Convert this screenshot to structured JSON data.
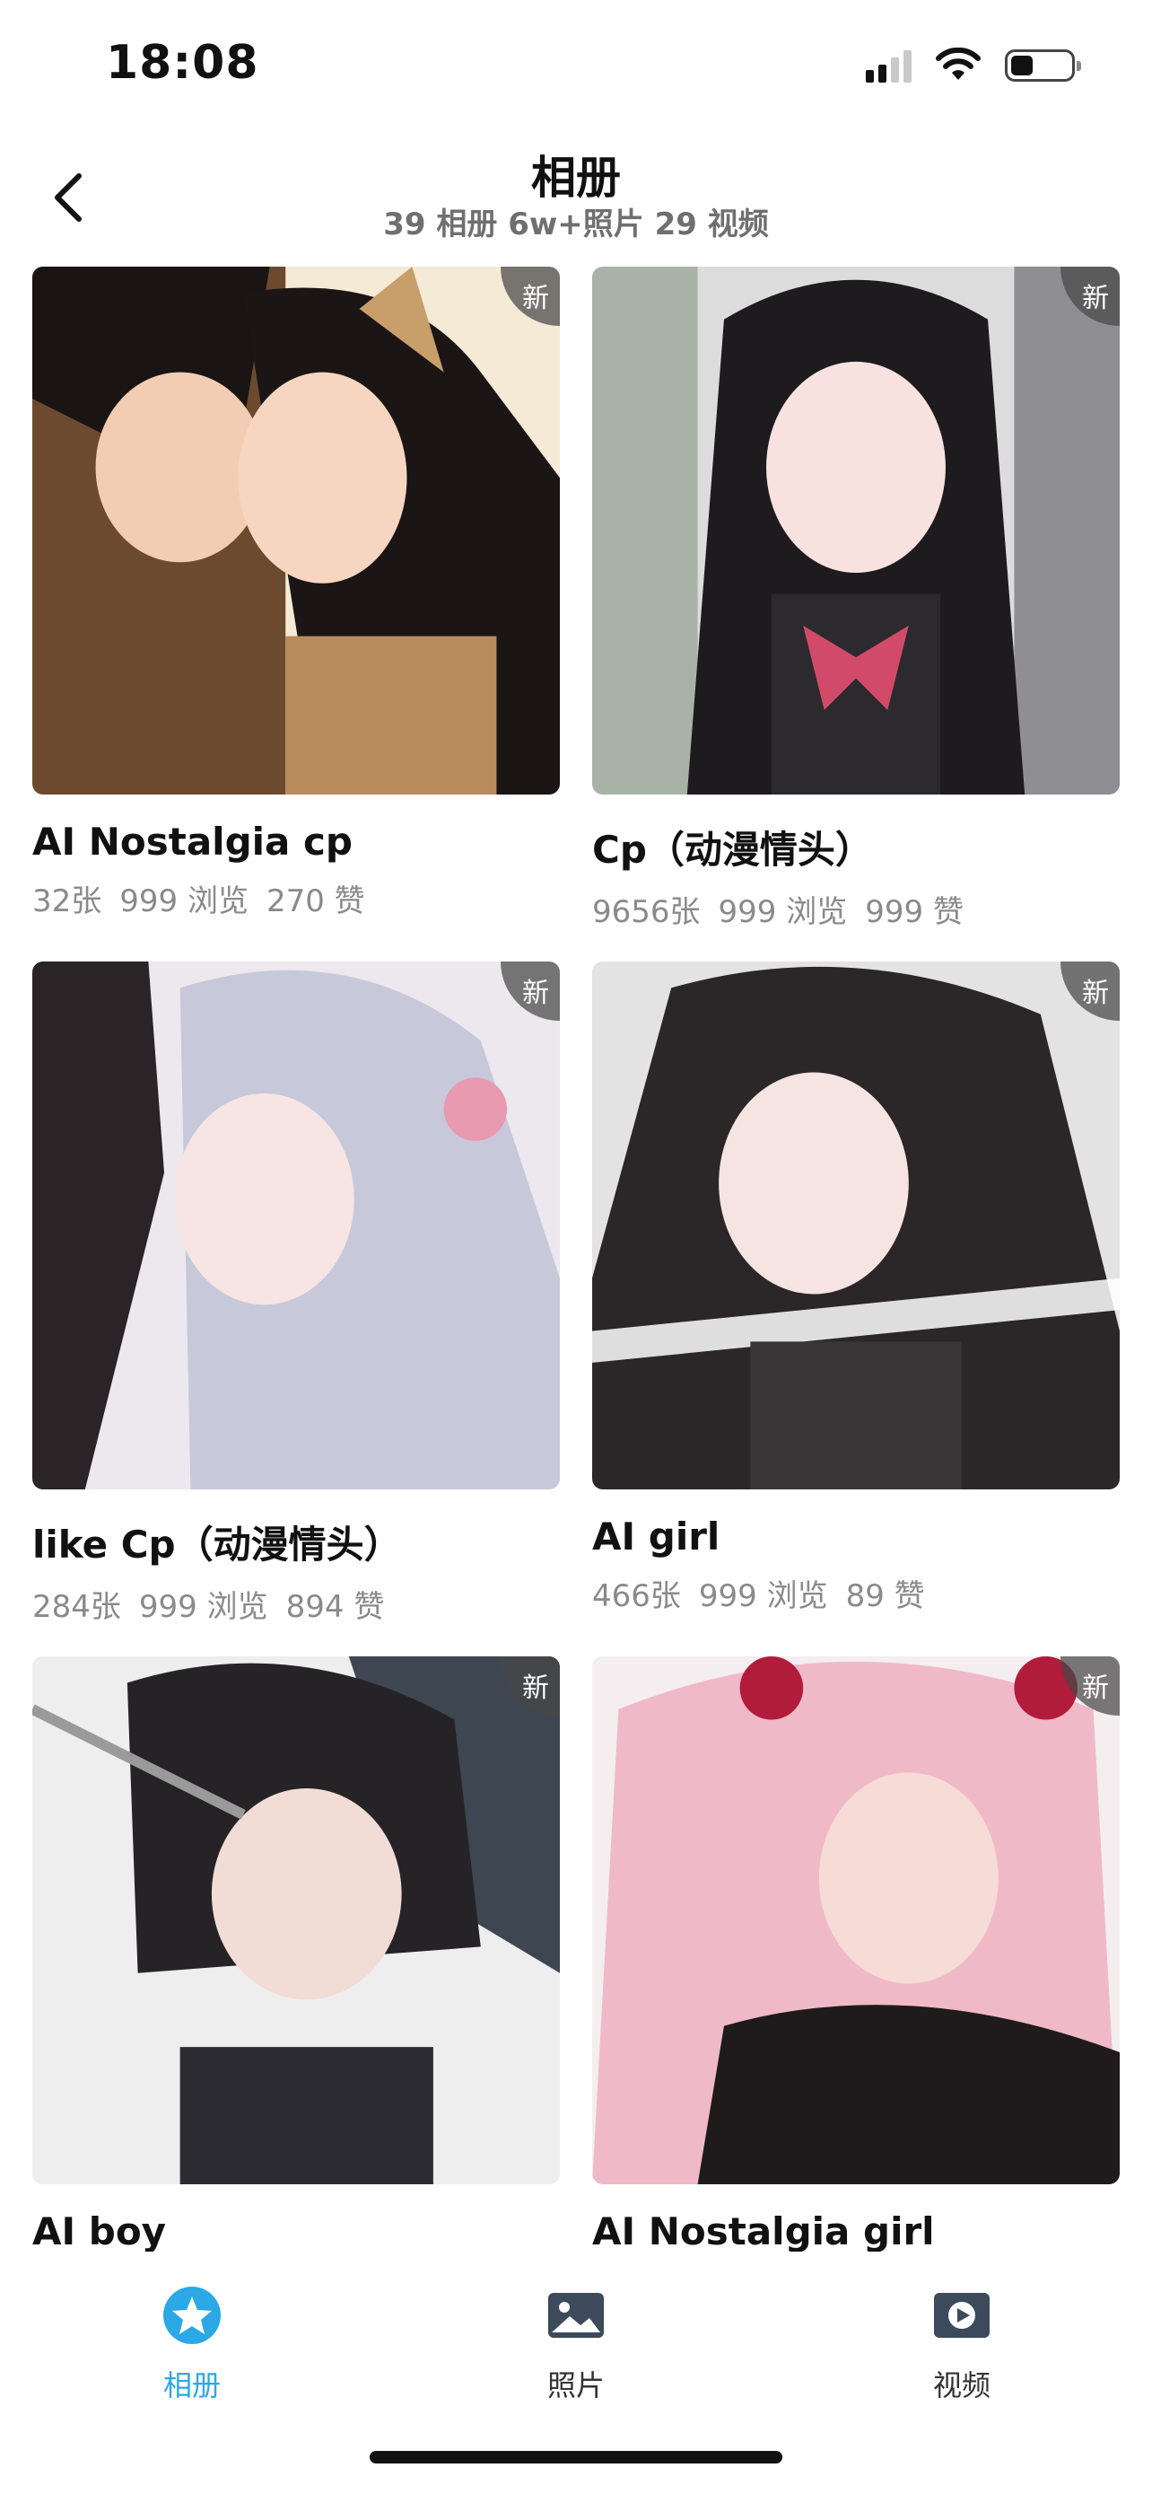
{
  "status_bar": {
    "time": "18:08"
  },
  "header": {
    "title": "相册",
    "subtitle": "39 相册 6w+照片 29 视频"
  },
  "albums": [
    {
      "title": "AI Nostalgia cp",
      "count": "32张",
      "views": "999 浏览",
      "likes": "270 赞",
      "badge": "新"
    },
    {
      "title": "Cp（动漫情头）",
      "count": "9656张",
      "views": "999 浏览",
      "likes": "999 赞",
      "badge": "新"
    },
    {
      "title": "like Cp（动漫情头）",
      "count": "284张",
      "views": "999 浏览",
      "likes": "894 赞",
      "badge": "新"
    },
    {
      "title": "AI girl",
      "count": "466张",
      "views": "999 浏览",
      "likes": "89 赞",
      "badge": "新"
    },
    {
      "title": "AI boy",
      "count": "",
      "views": "",
      "likes": "",
      "badge": "新"
    },
    {
      "title": "AI Nostalgia girl",
      "count": "",
      "views": "",
      "likes": "",
      "badge": "新"
    }
  ],
  "tabbar": {
    "items": [
      {
        "label": "相册",
        "icon": "album-star-icon",
        "active": true
      },
      {
        "label": "照片",
        "icon": "photo-icon",
        "active": false
      },
      {
        "label": "视频",
        "icon": "video-icon",
        "active": false
      }
    ]
  },
  "colors": {
    "accent": "#2aa9e6",
    "badge_bg": "#464646",
    "stats_text": "#8a8a8a"
  }
}
